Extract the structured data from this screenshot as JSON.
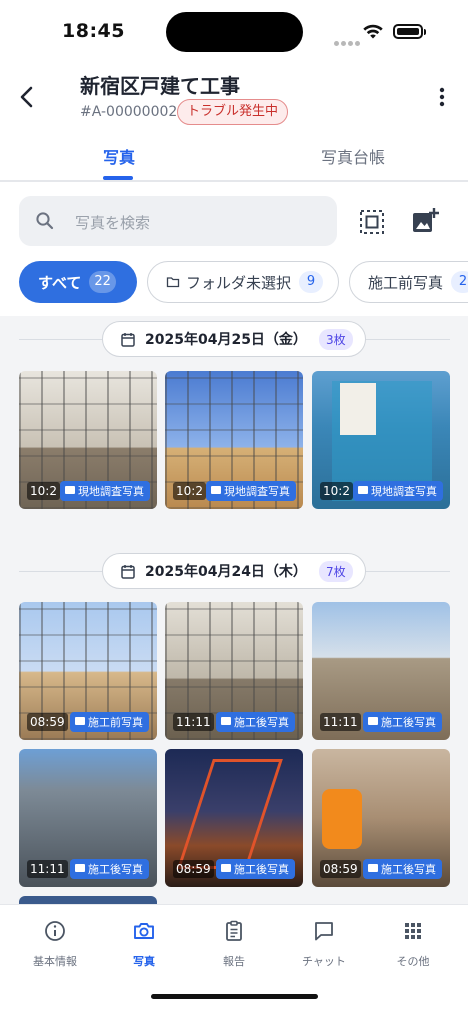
{
  "status_bar": {
    "time": "18:45"
  },
  "header": {
    "title": "新宿区戸建て工事",
    "code": "#A-00000002",
    "badge": "トラブル発生中"
  },
  "tabs": [
    {
      "label": "写真",
      "active": true
    },
    {
      "label": "写真台帳",
      "active": false
    }
  ],
  "search": {
    "placeholder": "写真を検索"
  },
  "filters": [
    {
      "label": "すべて",
      "count": "22",
      "active": true
    },
    {
      "label": "フォルダ未選択",
      "count": "9",
      "active": false
    },
    {
      "label": "施工前写真",
      "count": "2",
      "active": false
    }
  ],
  "groups": [
    {
      "date": "2025年04月25日（金）",
      "count": "3枚",
      "photos": [
        {
          "time": "10:2",
          "folder": "現地調査写真"
        },
        {
          "time": "10:2",
          "folder": "現地調査写真"
        },
        {
          "time": "10:2",
          "folder": "現地調査写真"
        }
      ]
    },
    {
      "date": "2025年04月24日（木）",
      "count": "7枚",
      "photos": [
        {
          "time": "08:59",
          "folder": "施工前写真"
        },
        {
          "time": "11:11",
          "folder": "施工後写真"
        },
        {
          "time": "11:11",
          "folder": "施工後写真"
        },
        {
          "time": "11:11",
          "folder": "施工後写真"
        },
        {
          "time": "08:59",
          "folder": "施工後写真"
        },
        {
          "time": "08:59",
          "folder": "施工後写真"
        }
      ]
    }
  ],
  "bottom_nav": [
    {
      "label": "基本情報",
      "icon": "info-icon",
      "active": false
    },
    {
      "label": "写真",
      "icon": "camera-icon",
      "active": true
    },
    {
      "label": "報告",
      "icon": "clipboard-icon",
      "active": false
    },
    {
      "label": "チャット",
      "icon": "chat-icon",
      "active": false
    },
    {
      "label": "その他",
      "icon": "grid-icon",
      "active": false
    }
  ],
  "colors": {
    "accent": "#2563eb",
    "badge_red": "#c9302c"
  }
}
